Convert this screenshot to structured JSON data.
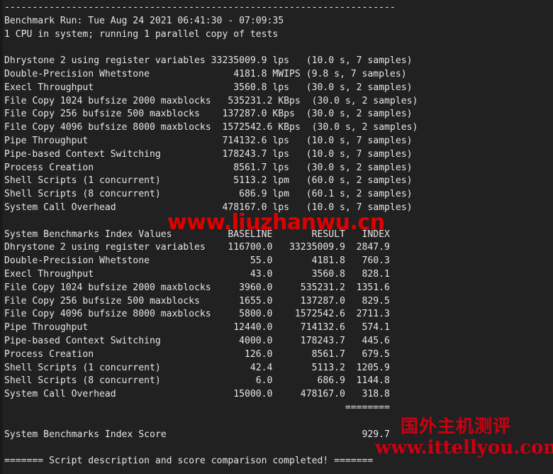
{
  "terminal": {
    "rule_top": "----------------------------------------------------------------------",
    "header_run": "Benchmark Run: Tue Aug 24 2021 06:41:30 - 07:09:35",
    "header_cpu": "1 CPU in system; running 1 parallel copy of tests",
    "footer": "======= Script description and score comparison completed! ======="
  },
  "results": {
    "rows": [
      {
        "name": "Dhrystone 2 using register variables",
        "value": "33235009.9",
        "unit": "lps",
        "timing": "(10.0 s, 7 samples)"
      },
      {
        "name": "Double-Precision Whetstone",
        "value": "4181.8",
        "unit": "MWIPS",
        "timing": "(9.8 s, 7 samples)"
      },
      {
        "name": "Execl Throughput",
        "value": "3560.8",
        "unit": "lps",
        "timing": "(30.0 s, 2 samples)"
      },
      {
        "name": "File Copy 1024 bufsize 2000 maxblocks",
        "value": "535231.2",
        "unit": "KBps",
        "timing": "(30.0 s, 2 samples)"
      },
      {
        "name": "File Copy 256 bufsize 500 maxblocks",
        "value": "137287.0",
        "unit": "KBps",
        "timing": "(30.0 s, 2 samples)"
      },
      {
        "name": "File Copy 4096 bufsize 8000 maxblocks",
        "value": "1572542.6",
        "unit": "KBps",
        "timing": "(30.0 s, 2 samples)"
      },
      {
        "name": "Pipe Throughput",
        "value": "714132.6",
        "unit": "lps",
        "timing": "(10.0 s, 7 samples)"
      },
      {
        "name": "Pipe-based Context Switching",
        "value": "178243.7",
        "unit": "lps",
        "timing": "(10.0 s, 7 samples)"
      },
      {
        "name": "Process Creation",
        "value": "8561.7",
        "unit": "lps",
        "timing": "(30.0 s, 2 samples)"
      },
      {
        "name": "Shell Scripts (1 concurrent)",
        "value": "5113.2",
        "unit": "lpm",
        "timing": "(60.0 s, 2 samples)"
      },
      {
        "name": "Shell Scripts (8 concurrent)",
        "value": "686.9",
        "unit": "lpm",
        "timing": "(60.1 s, 2 samples)"
      },
      {
        "name": "System Call Overhead",
        "value": "478167.0",
        "unit": "lps",
        "timing": "(10.0 s, 7 samples)"
      }
    ]
  },
  "index_table": {
    "title": "System Benchmarks Index Values",
    "columns": [
      "BASELINE",
      "RESULT",
      "INDEX"
    ],
    "rows": [
      {
        "name": "Dhrystone 2 using register variables",
        "baseline": "116700.0",
        "result": "33235009.9",
        "index": "2847.9"
      },
      {
        "name": "Double-Precision Whetstone",
        "baseline": "55.0",
        "result": "4181.8",
        "index": "760.3"
      },
      {
        "name": "Execl Throughput",
        "baseline": "43.0",
        "result": "3560.8",
        "index": "828.1"
      },
      {
        "name": "File Copy 1024 bufsize 2000 maxblocks",
        "baseline": "3960.0",
        "result": "535231.2",
        "index": "1351.6"
      },
      {
        "name": "File Copy 256 bufsize 500 maxblocks",
        "baseline": "1655.0",
        "result": "137287.0",
        "index": "829.5"
      },
      {
        "name": "File Copy 4096 bufsize 8000 maxblocks",
        "baseline": "5800.0",
        "result": "1572542.6",
        "index": "2711.3"
      },
      {
        "name": "Pipe Throughput",
        "baseline": "12440.0",
        "result": "714132.6",
        "index": "574.1"
      },
      {
        "name": "Pipe-based Context Switching",
        "baseline": "4000.0",
        "result": "178243.7",
        "index": "445.6"
      },
      {
        "name": "Process Creation",
        "baseline": "126.0",
        "result": "8561.7",
        "index": "679.5"
      },
      {
        "name": "Shell Scripts (1 concurrent)",
        "baseline": "42.4",
        "result": "5113.2",
        "index": "1205.9"
      },
      {
        "name": "Shell Scripts (8 concurrent)",
        "baseline": "6.0",
        "result": "686.9",
        "index": "1144.8"
      },
      {
        "name": "System Call Overhead",
        "baseline": "15000.0",
        "result": "478167.0",
        "index": "318.8"
      }
    ],
    "separator": "========",
    "score_label": "System Benchmarks Index Score",
    "score_value": "929.7"
  },
  "watermarks": {
    "site_url_top": "www.liuzhanwu.cn",
    "site_name_cn": "国外主机测评",
    "site_url_bottom": "www.ittellyou.com",
    "color": "#cc0010"
  }
}
